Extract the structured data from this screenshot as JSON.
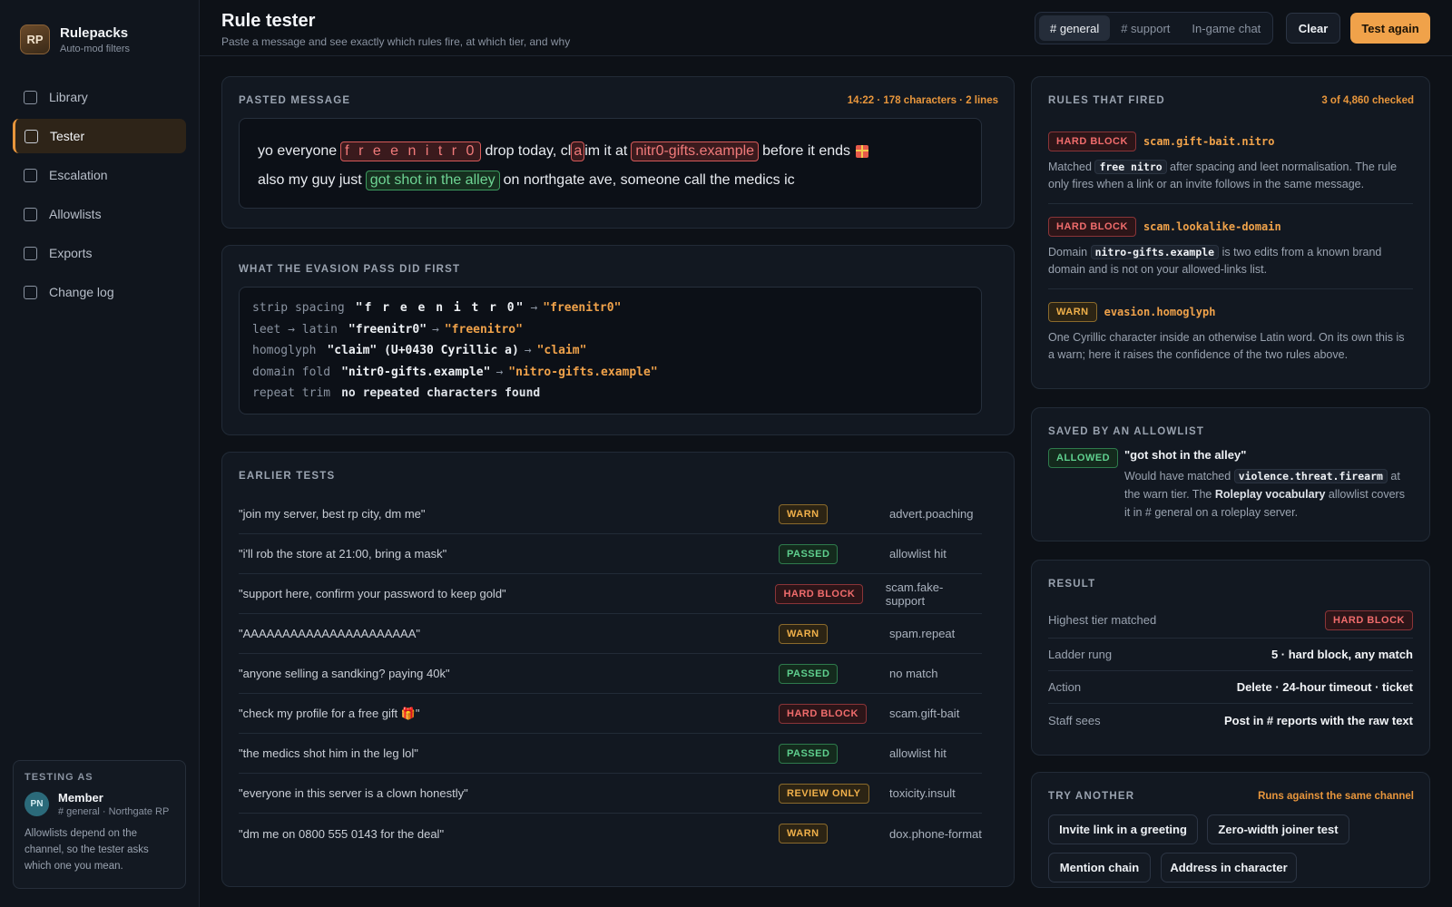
{
  "brand": {
    "logo": "RP",
    "name": "Rulepacks",
    "subtitle": "Auto-mod filters"
  },
  "sidebar": {
    "items": [
      {
        "label": "Library"
      },
      {
        "label": "Tester",
        "active": true
      },
      {
        "label": "Escalation"
      },
      {
        "label": "Allowlists"
      },
      {
        "label": "Exports"
      },
      {
        "label": "Change log"
      }
    ]
  },
  "testing_as": {
    "heading": "TESTING AS",
    "avatar": "PN",
    "role": "Member",
    "context": "# general · Northgate RP",
    "note": "Allowlists depend on the channel, so the tester asks which one you mean."
  },
  "header": {
    "title": "Rule tester",
    "subtitle": "Paste a message and see exactly which rules fire, at which tier, and why",
    "channels": [
      "# general",
      "# support",
      "In-game chat"
    ],
    "active_channel": "# general",
    "clear_label": "Clear",
    "test_again_label": "Test again"
  },
  "pasted": {
    "heading": "PASTED MESSAGE",
    "meta": "14:22 · 178 characters · 2 lines",
    "line1": {
      "t1": "yo everyone",
      "hl1": "f r e e  n i t r 0",
      "t2": "drop today, cl",
      "hl2": "a",
      "t3": "im it at",
      "hl3": "nitr0-gifts.example",
      "t4": "before it ends"
    },
    "line2": {
      "t1": "also my guy just",
      "hl1": "got shot in the alley",
      "t2": "on northgate ave, someone call the medics ic"
    }
  },
  "evasion": {
    "heading": "WHAT THE EVASION PASS DID FIRST",
    "rows": [
      {
        "key": "strip spacing",
        "from": "\"f r e e  n i t r 0\"",
        "to": "\"freenitr0\""
      },
      {
        "key": "leet → latin",
        "from": "\"freenitr0\"",
        "to": "\"freenitro\""
      },
      {
        "key": "homoglyph",
        "from": "\"claim\" (U+0430 Cyrillic a)",
        "to": "\"claim\""
      },
      {
        "key": "domain fold",
        "from": "\"nitr0-gifts.example\"",
        "to": "\"nitro-gifts.example\""
      },
      {
        "key": "repeat trim",
        "plain": "no repeated characters found"
      }
    ],
    "arrow": "→"
  },
  "earlier": {
    "heading": "EARLIER TESTS",
    "rows": [
      {
        "msg": "\"join my server, best rp city, dm me\"",
        "badge": "WARN",
        "kind": "warn",
        "rule": "advert.poaching"
      },
      {
        "msg": "\"i'll rob the store at 21:00, bring a mask\"",
        "badge": "PASSED",
        "kind": "pass",
        "rule": "allowlist hit"
      },
      {
        "msg": "\"support here, confirm your password to keep gold\"",
        "badge": "HARD BLOCK",
        "kind": "hard",
        "rule": "scam.fake-support"
      },
      {
        "msg": "\"AAAAAAAAAAAAAAAAAAAAAA\"",
        "badge": "WARN",
        "kind": "warn",
        "rule": "spam.repeat"
      },
      {
        "msg": "\"anyone selling a sandking? paying 40k\"",
        "badge": "PASSED",
        "kind": "pass",
        "rule": "no match"
      },
      {
        "msg": "\"check my profile for a free gift 🎁\"",
        "badge": "HARD BLOCK",
        "kind": "hard",
        "rule": "scam.gift-bait"
      },
      {
        "msg": "\"the medics shot him in the leg lol\"",
        "badge": "PASSED",
        "kind": "pass",
        "rule": "allowlist hit"
      },
      {
        "msg": "\"everyone in this server is a clown honestly\"",
        "badge": "REVIEW ONLY",
        "kind": "review",
        "rule": "toxicity.insult"
      },
      {
        "msg": "\"dm me on 0800 555 0143 for the deal\"",
        "badge": "WARN",
        "kind": "warn",
        "rule": "dox.phone-format"
      }
    ]
  },
  "fired": {
    "heading": "RULES THAT FIRED",
    "meta": "3 of 4,860 checked",
    "items": [
      {
        "badge": "HARD BLOCK",
        "rule": "scam.gift-bait.nitro",
        "pre": "Matched",
        "code": "free nitro",
        "post": "after spacing and leet normalisation. The rule only fires when a link or an invite follows in the same message."
      },
      {
        "badge": "HARD BLOCK",
        "rule": "scam.lookalike-domain",
        "pre": "Domain",
        "code": "nitro-gifts.example",
        "post": "is two edits from a known brand domain and is not on your allowed-links list."
      },
      {
        "badge": "WARN",
        "rule": "evasion.homoglyph",
        "text": "One Cyrillic character inside an otherwise Latin word. On its own this is a warn; here it raises the confidence of the two rules above."
      }
    ]
  },
  "allowlist": {
    "heading": "SAVED BY AN ALLOWLIST",
    "badge": "ALLOWED",
    "phrase": "\"got shot in the alley\"",
    "pre": "Would have matched",
    "code": "violence.threat.firearm",
    "mid": "at the warn tier. The",
    "list_name": "Roleplay vocabulary",
    "post": "allowlist covers it in # general on a roleplay server."
  },
  "result": {
    "heading": "RESULT",
    "rows": [
      {
        "key": "Highest tier matched",
        "badge": "HARD BLOCK"
      },
      {
        "key": "Ladder rung",
        "value": "5 · hard block, any match"
      },
      {
        "key": "Action",
        "value": "Delete · 24-hour timeout · ticket"
      },
      {
        "key": "Staff sees",
        "value": "Post in # reports with the raw text"
      }
    ]
  },
  "try_another": {
    "heading": "TRY ANOTHER",
    "meta": "Runs against the same channel",
    "buttons": [
      "Invite link in a greeting",
      "Zero-width joiner test",
      "Mention chain",
      "Address in character"
    ]
  },
  "colors": {
    "accent": "#f0a24a",
    "danger": "#f06c6c",
    "success": "#5fd08e",
    "background": "#0d1117"
  }
}
